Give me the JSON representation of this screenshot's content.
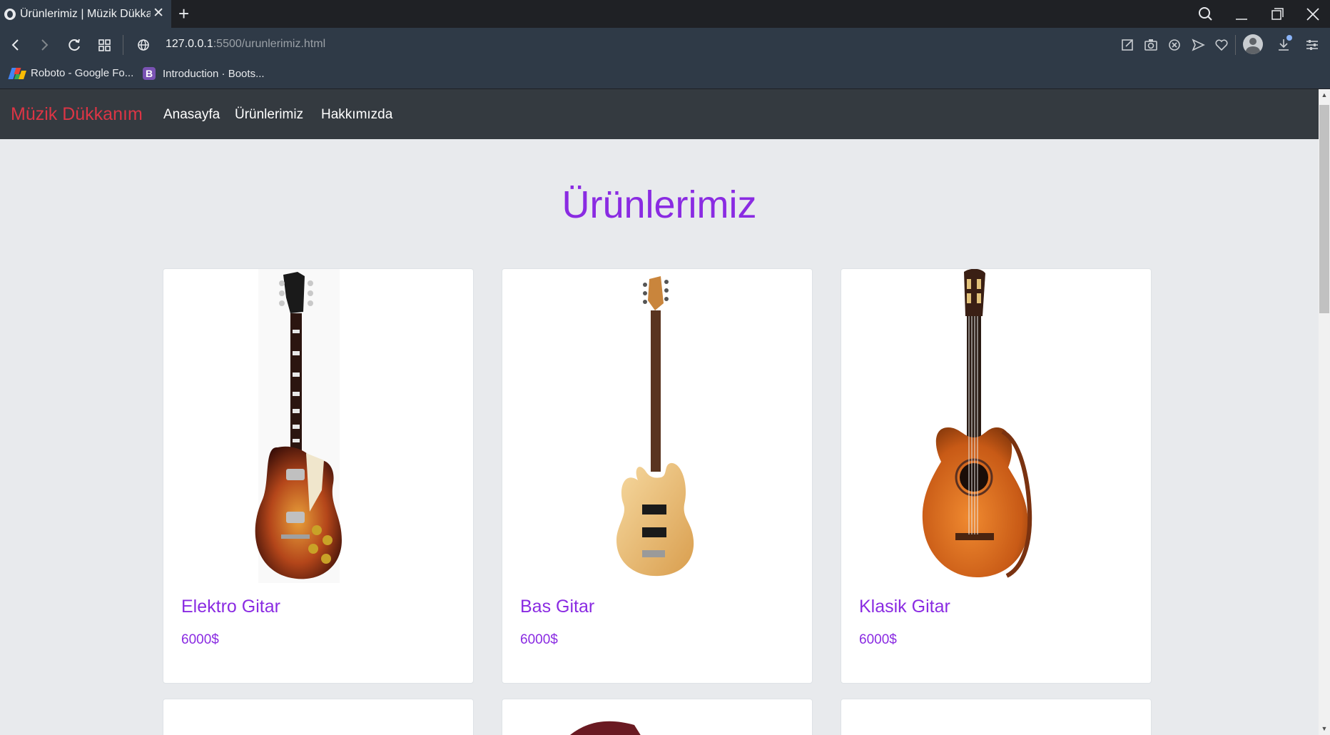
{
  "browser": {
    "tab_title": "Ürünlerimiz | Müzik Dükkanım",
    "tab_close": "✕",
    "new_tab": "+",
    "url_host": "127.0.0.1",
    "url_path": ":5500/urunlerimiz.html",
    "bookmarks": [
      {
        "label": "Roboto - Google Fo..."
      },
      {
        "label": "Introduction · Boots...",
        "icon_letter": "B"
      }
    ]
  },
  "navbar": {
    "brand": "Müzik Dükkanım",
    "links": [
      "Anasayfa",
      "Ürünlerimiz",
      "Hakkımızda"
    ]
  },
  "page": {
    "title": "Ürünlerimiz",
    "products": [
      {
        "name": "Elektro Gitar",
        "price": "6000$",
        "image": "electric-guitar"
      },
      {
        "name": "Bas Gitar",
        "price": "6000$",
        "image": "bass-guitar"
      },
      {
        "name": "Klasik Gitar",
        "price": "6000$",
        "image": "classical-guitar"
      }
    ]
  },
  "colors": {
    "accent": "#8a2be2",
    "brand": "#dc3545",
    "navbar": "#343a40",
    "page_bg": "#e8eaed"
  }
}
